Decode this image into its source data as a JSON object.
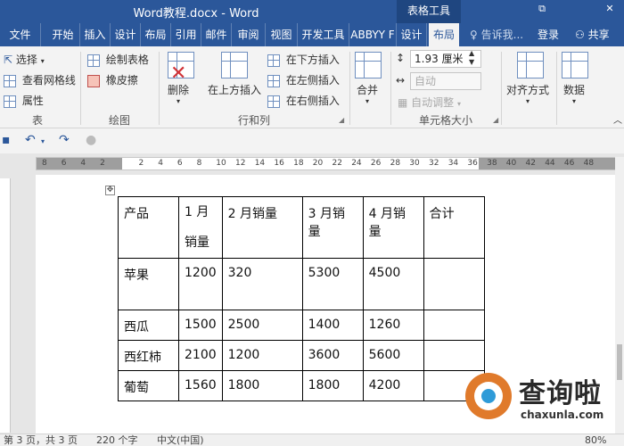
{
  "window": {
    "title": "Word教程.docx - Word",
    "contextual_tab_group": "表格工具",
    "restore_glyph": "⧉",
    "close_glyph": "✕"
  },
  "tabs": [
    "文件",
    "开始",
    "插入",
    "设计",
    "布局",
    "引用",
    "邮件",
    "审阅",
    "视图",
    "开发工具",
    "ABBYY F",
    "设计",
    "布局"
  ],
  "tell_me": "告诉我...",
  "login": "登录",
  "share": "共享",
  "ribbon": {
    "table_group": {
      "select": "选择",
      "view_gridlines": "查看网格线",
      "properties": "属性",
      "label": "表"
    },
    "draw_group": {
      "draw_table": "绘制表格",
      "eraser": "橡皮擦",
      "label": "绘图"
    },
    "rows_cols_group": {
      "delete": "删除",
      "insert_above": "在上方插入",
      "insert_below": "在下方插入",
      "insert_left": "在左侧插入",
      "insert_right": "在右侧插入",
      "label": "行和列"
    },
    "merge_group": {
      "merge": "合并"
    },
    "cell_size_group": {
      "height_value": "1.93 厘米",
      "width_value": "自动",
      "autofit": "自动调整",
      "label": "单元格大小"
    },
    "alignment": "对齐方式",
    "data": "数据"
  },
  "ruler_numbers": [
    "8",
    "6",
    "4",
    "2",
    "",
    "2",
    "4",
    "6",
    "8",
    "10",
    "12",
    "14",
    "16",
    "18",
    "20",
    "22",
    "24",
    "26",
    "28",
    "30",
    "32",
    "34",
    "36",
    "38",
    "40",
    "42",
    "44",
    "46",
    "48"
  ],
  "table": {
    "rows": [
      [
        "产品",
        "1 月销量",
        "2 月销量",
        "3 月销量",
        "4 月销量",
        "合计"
      ],
      [
        "苹果",
        "1200",
        "320",
        "5300",
        "4500",
        ""
      ],
      [
        "西瓜",
        "1500",
        "2500",
        "1400",
        "1260",
        ""
      ],
      [
        "西红柿",
        "2100",
        "1200",
        "3600",
        "5600",
        ""
      ],
      [
        "葡萄",
        "1560",
        "1800",
        "1800",
        "4200",
        ""
      ]
    ]
  },
  "status": {
    "page": "第 3 页，共 3 页",
    "words": "220 个字",
    "language": "中文(中国)",
    "zoom": "80%"
  },
  "watermark": {
    "text": "查询啦",
    "url": "chaxunla.com"
  }
}
